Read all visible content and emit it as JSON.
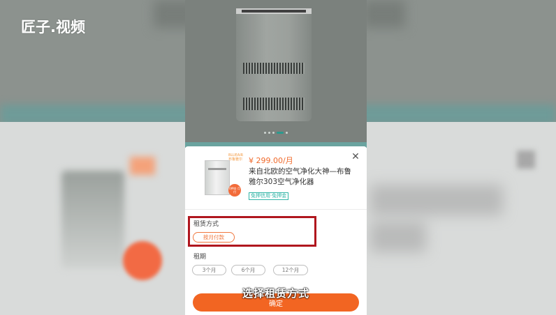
{
  "watermark": "匠子.视频",
  "carousel": {
    "dot_count": 5,
    "active_index": 3
  },
  "product": {
    "price": "¥ 299.00/月",
    "title": "来自北欧的空气净化大神—布鲁雅尔303空气净化器",
    "tag": "免押信用·免押金",
    "thumb_brand": "BLUEAIR 布鲁雅尔",
    "thumb_badge": "0押金 月付"
  },
  "rental_mode": {
    "label": "租赁方式",
    "option": "按月付款"
  },
  "rental_term": {
    "label": "租期",
    "options": [
      "3个月",
      "6个月",
      "12个月"
    ]
  },
  "confirm_label": "确定",
  "subtitle": "选择租赁方式",
  "colors": {
    "accent": "#f26522",
    "highlight_border": "#b0161e",
    "teal": "#2fb4a6"
  }
}
